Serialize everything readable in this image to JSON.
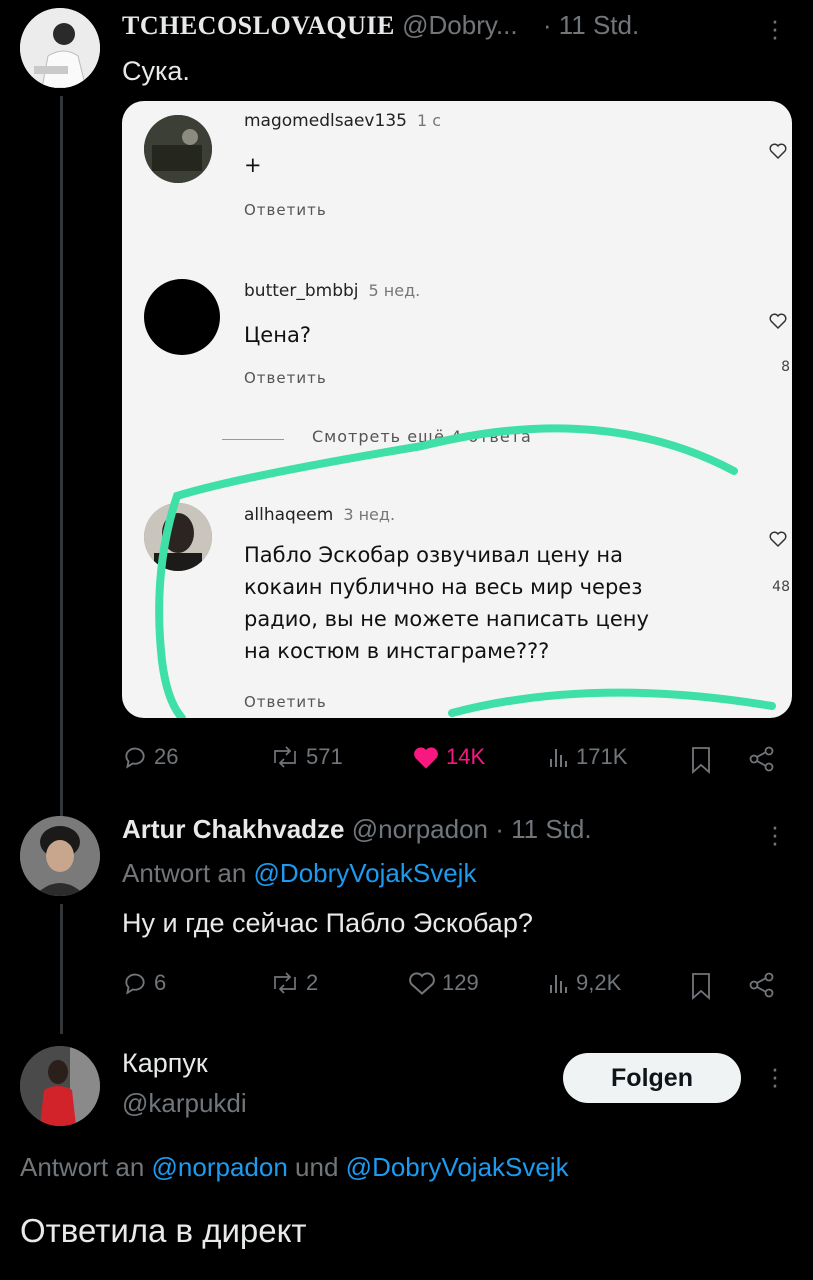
{
  "tweet1": {
    "display_name": "TCHECOSLOVAQUIE",
    "handle": "@Dobry...",
    "time": "· 11 Std.",
    "text": "Сука.",
    "stats": {
      "replies": "26",
      "retweets": "571",
      "likes": "14K",
      "views": "171K"
    },
    "embedded": {
      "comments": [
        {
          "user": "magomedlsaev135",
          "time": "1 с",
          "text": "+",
          "reply": "Ответить"
        },
        {
          "user": "butter_bmbbj",
          "time": "5 нед.",
          "text": "Цена?",
          "reply": "Ответить",
          "count": "8"
        },
        {
          "view_more": "Смотреть ещё 4 ответа"
        },
        {
          "user": "allhaqeem",
          "time": "3 нед.",
          "text_lines": [
            "Пабло Эскобар озвучивал цену на",
            "кокаин публично на весь мир через",
            "радио, вы не можете написать цену",
            "на костюм в инстаграме???"
          ],
          "reply": "Ответить",
          "count": "48"
        }
      ]
    }
  },
  "tweet2": {
    "display_name": "Artur Chakhvadze",
    "handle": "@norpadon",
    "time": "· 11 Std.",
    "reply_prefix": "Antwort an",
    "reply_to": "@DobryVojakSvejk",
    "text": "Ну и где сейчас Пабло Эскобар?",
    "stats": {
      "replies": "6",
      "retweets": "2",
      "likes": "129",
      "views": "9,2K"
    }
  },
  "tweet3": {
    "display_name": "Карпук",
    "handle": "@karpukdi",
    "follow_label": "Folgen",
    "reply_prefix": "Antwort an",
    "reply_to_1": "@norpadon",
    "reply_and": "und",
    "reply_to_2": "@DobryVojakSvejk",
    "text": "Ответила в директ"
  },
  "colors": {
    "background": "#000000",
    "link": "#1d9bf0",
    "like": "#f91880",
    "highlight": "#3ee0a8"
  }
}
